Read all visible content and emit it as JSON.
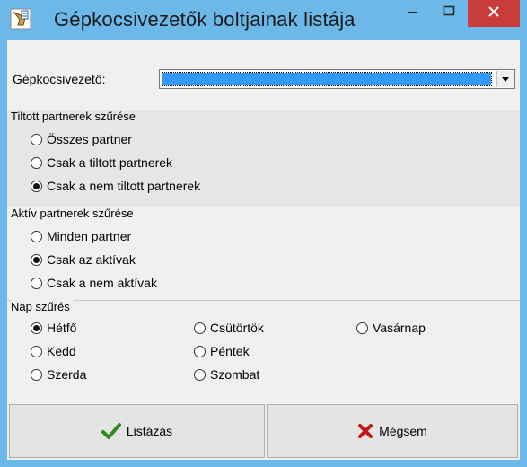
{
  "window": {
    "title": "Gépkocsivezetők boltjainak listája",
    "icons": {
      "app": "hand-document-icon",
      "minimize": "minimize-icon",
      "maximize": "maximize-icon",
      "close": "close-icon"
    },
    "colors": {
      "titlebar": "#6cb8e8",
      "close": "#c83c3c",
      "selection": "#3399ff"
    }
  },
  "driver": {
    "label": "Gépkocsivezető:",
    "value": ""
  },
  "groups": {
    "forbidden": {
      "title": "Tiltott partnerek szűrése",
      "options": [
        "Összes partner",
        "Csak a tiltott partnerek",
        "Csak a nem tiltott partnerek"
      ],
      "selected": 2
    },
    "active": {
      "title": "Aktív partnerek szűrése",
      "options": [
        "Minden partner",
        "Csak az aktívak",
        "Csak a nem aktívak"
      ],
      "selected": 1
    },
    "day": {
      "title": "Nap szűrés",
      "options": [
        "Hétfő",
        "Kedd",
        "Szerda",
        "Csütörtök",
        "Péntek",
        "Szombat",
        "Vasárnap"
      ],
      "selected": 0
    }
  },
  "buttons": {
    "list": {
      "label": "Listázás",
      "icon": "checkmark-icon"
    },
    "cancel": {
      "label": "Mégsem",
      "icon": "x-cross-icon"
    }
  }
}
